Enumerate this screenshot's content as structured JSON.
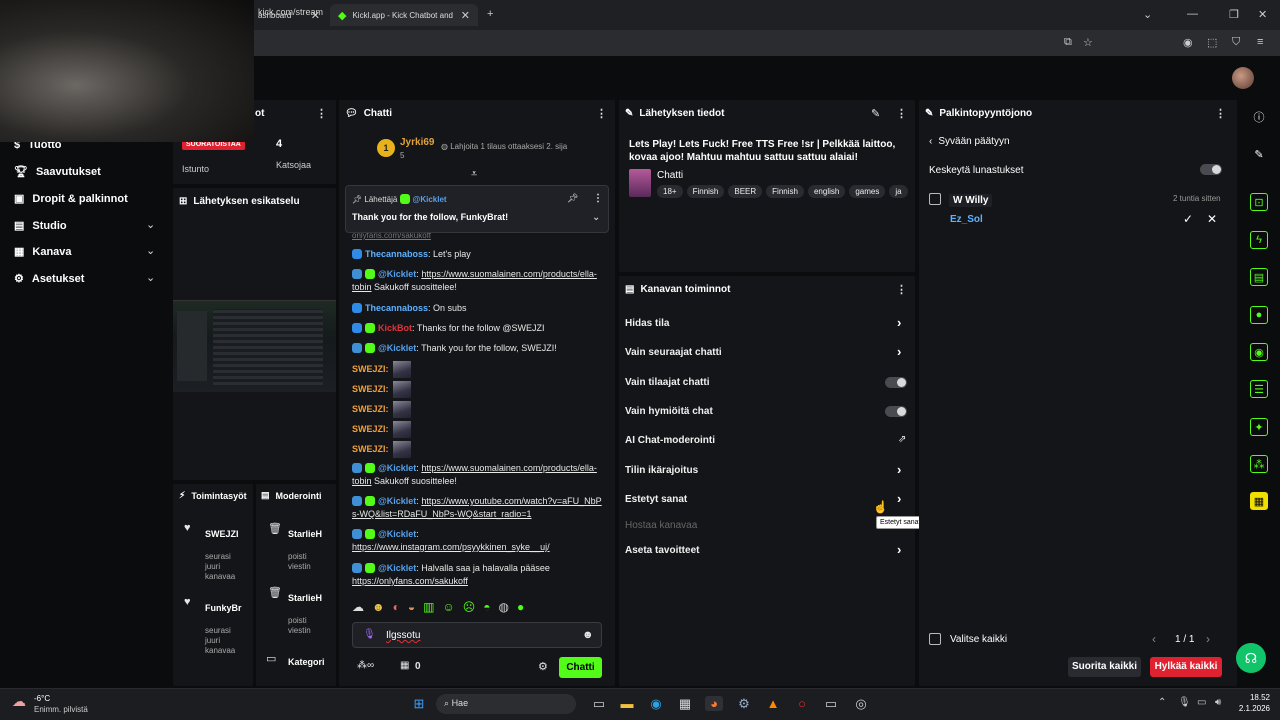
{
  "browser": {
    "tab1_title": "ashboard",
    "tab2_title": "Kickl.app - Kick Chatbot and",
    "url": "kick.com/stream"
  },
  "sidebar": {
    "items": [
      {
        "label": "Tuotto"
      },
      {
        "label": "Saavutukset"
      },
      {
        "label": "Dropit & palkinnot"
      },
      {
        "label": "Studio"
      },
      {
        "label": "Kanava"
      },
      {
        "label": "Asetukset"
      }
    ]
  },
  "stream_panel": {
    "header": "ot",
    "live_badge": "SUORATOISTAA",
    "session_label": "Istunto",
    "viewer_count": "4",
    "viewer_label": "Katsojaa",
    "preview_title": "Lähetyksen esikatselu"
  },
  "activity_panel": {
    "title": "Toimintasyöt",
    "items": [
      {
        "name": "SWEJZI",
        "text": "seurasi juuri kanavaa"
      },
      {
        "name": "FunkyBr",
        "text": "seurasi juuri kanavaa"
      }
    ]
  },
  "mod_panel": {
    "title": "Moderointi",
    "items": [
      {
        "name": "StarlieH",
        "text": "poisti viestin"
      },
      {
        "name": "StarlieH",
        "text": "poisti viestin"
      },
      {
        "name": "Kategori",
        "text": ""
      }
    ]
  },
  "chat": {
    "title": "Chatti",
    "top_gifter_rank": "1",
    "top_gifter_name": "Jyrki69",
    "top_gifter_count": "5",
    "gift_prompt": "Lahjoita 1 tilaus ottaaksesi 2. sija",
    "pinned_label": "Lähettäjä",
    "pinned_user": "@Kicklet",
    "pinned_text": "Thank you for the follow, FunkyBrat!",
    "partial_line": "onlyfans.com/sakukoff",
    "messages": [
      {
        "user": "Thecannaboss",
        "text": ": Let's play"
      },
      {
        "user": "@Kicklet",
        "link": "https://www.suomalainen.com/products/ella-tobin",
        "text": " Sakukoff suosittelee!"
      },
      {
        "user": "Thecannaboss",
        "text": ": On subs"
      },
      {
        "user": "KickBot",
        "text": ": Thanks for the follow @SWEJZI"
      },
      {
        "user": "@Kicklet",
        "text": ": Thank you for the follow, SWEJZI!"
      },
      {
        "user": "SWEJZI:"
      },
      {
        "user": "SWEJZI:"
      },
      {
        "user": "SWEJZI:"
      },
      {
        "user": "SWEJZI:"
      },
      {
        "user": "SWEJZI:"
      },
      {
        "user": "@Kicklet",
        "link": "https://www.suomalainen.com/products/ella-tobin",
        "text": " Sakukoff suosittelee!"
      },
      {
        "user": "@Kicklet",
        "link": "https://www.youtube.com/watch?v=aFU_NbPs-WQ&list=RDaFU_NbPs-WQ&start_radio=1"
      },
      {
        "user": "@Kicklet",
        "link": "https://www.instagram.com/psyykkinen_syke__uj/"
      },
      {
        "user": "@Kicklet",
        "text": ": Halvalla saa ja halavalla pääsee ",
        "link": "https://onlyfans.com/sakukoff"
      }
    ],
    "input_value": "Ilgssotu",
    "points": "0",
    "send_button": "Chatti"
  },
  "stream_info": {
    "title": "Lähetyksen tiedot",
    "stream_title": "Lets Play! Lets Fuck! Free TTS Free !sr | Pelkkää laittoo, kovaa ajoo! Mahtuu mahtuu sattuu sattuu alaiai!",
    "category": "Chatti",
    "tags": [
      "18+",
      "Finnish",
      "BEER",
      "Finnish",
      "english",
      "games",
      "ja"
    ]
  },
  "channel_actions": {
    "title": "Kanavan toiminnot",
    "items": [
      {
        "label": "Hidas tila"
      },
      {
        "label": "Vain seuraajat chatti"
      },
      {
        "label": "Vain tilaajat chatti"
      },
      {
        "label": "Vain hymiöitä chat"
      },
      {
        "label": "AI Chat-moderointi"
      },
      {
        "label": "Tilin ikärajoitus"
      },
      {
        "label": "Estetyt sanat"
      },
      {
        "label": "Hostaa kanavaa"
      },
      {
        "label": "Aseta tavoitteet"
      }
    ],
    "tooltip": "Estetyt sanat"
  },
  "rewards": {
    "title": "Palkintopyyntöjono",
    "back_label": "Syvään päätyyn",
    "pause_label": "Keskeytä lunastukset",
    "request_title": "W Willy",
    "request_time": "2 tuntia sitten",
    "request_user": "Ez_Sol",
    "select_all": "Valitse kaikki",
    "page": "1 / 1",
    "approve_all": "Suorita kaikki",
    "reject_all": "Hylkää kaikki"
  },
  "taskbar": {
    "temp": "-6°C",
    "weather": "Enimm. pilvistä",
    "search": "Hae",
    "time": "18.52",
    "date": "2.1.2026"
  },
  "colors": {
    "accent": "#53fc18",
    "danger": "#e0212f",
    "panel": "#141518"
  }
}
